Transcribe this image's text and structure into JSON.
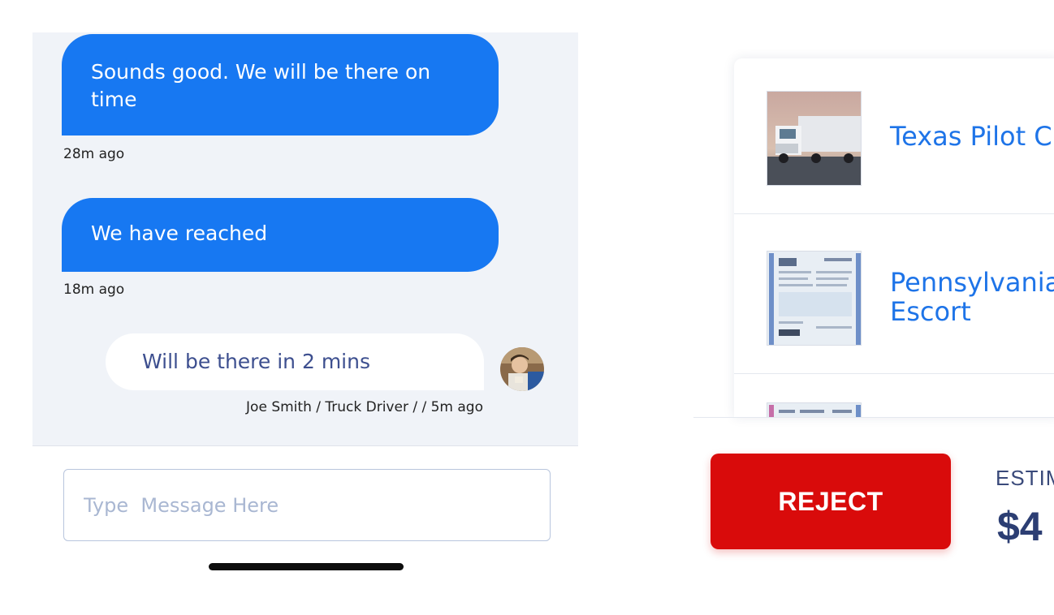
{
  "chat": {
    "messages": [
      {
        "text": "Sounds good. We will be there on time",
        "time": "28m ago"
      },
      {
        "text": "We have reached",
        "time": "18m ago"
      }
    ],
    "reply": {
      "text": "Will be there in 2 mins",
      "meta": "Joe Smith / Truck Driver /  / 5m ago"
    },
    "input_placeholder": "Type  Message Here"
  },
  "documents": [
    {
      "title": "Texas Pilot C",
      "thumb": "truck-photo"
    },
    {
      "title": "Pennsylvania\nEscort",
      "thumb": "permit-document"
    },
    {
      "title": "",
      "thumb": "permit-document"
    }
  ],
  "actions": {
    "reject_label": "REJECT",
    "estimate_label": "ESTIM",
    "estimate_value": "$4"
  },
  "colors": {
    "primary_blue": "#1778f2",
    "reject_red": "#d90b0b",
    "chat_bg": "#f0f3f8",
    "navy_text": "#2c3e73"
  }
}
